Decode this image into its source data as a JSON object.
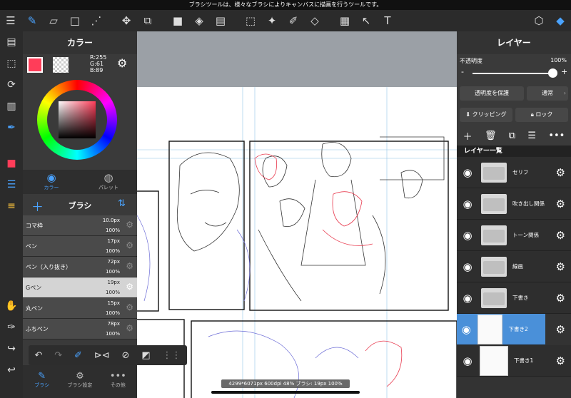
{
  "status_message": "ブラシツールは、様々なブラシによりキャンバスに描画を行うツールです。",
  "color_panel": {
    "title": "カラー",
    "rgb": {
      "r": "R:255",
      "g": "G:61",
      "b": "B:89"
    },
    "main_color": "#ff3d59",
    "tab_color": "カラー",
    "tab_palette": "パレット"
  },
  "brush_panel": {
    "title": "ブラシ",
    "items": [
      {
        "name": "コマ枠",
        "size": "10.0px",
        "opacity": "100%"
      },
      {
        "name": "ペン",
        "size": "17px",
        "opacity": "100%"
      },
      {
        "name": "ペン（入り抜き）",
        "size": "72px",
        "opacity": "100%"
      },
      {
        "name": "Gペン",
        "size": "19px",
        "opacity": "100%"
      },
      {
        "name": "丸ペン",
        "size": "15px",
        "opacity": "100%"
      },
      {
        "name": "ふちペン",
        "size": "78px",
        "opacity": "100%"
      }
    ],
    "tabs": [
      "ブラシ",
      "ブラシ設定",
      "その他"
    ]
  },
  "layer_panel": {
    "title": "レイヤー",
    "opacity_label": "不透明度",
    "opacity_value": "100%",
    "protect_button": "透明度を保護",
    "blend_mode": "通常",
    "clipping_button": "クリッピング",
    "lock_button": "ロック",
    "list_title": "レイヤー一覧",
    "layers": [
      {
        "name": "セリフ"
      },
      {
        "name": "吹き出し関係"
      },
      {
        "name": "トーン関係"
      },
      {
        "name": "線画"
      },
      {
        "name": "下書き"
      },
      {
        "name": "下書き2"
      },
      {
        "name": "下書き1"
      }
    ]
  },
  "canvas_info": "4299*6071px 600dpi 48% ブラシ: 19px 100%"
}
